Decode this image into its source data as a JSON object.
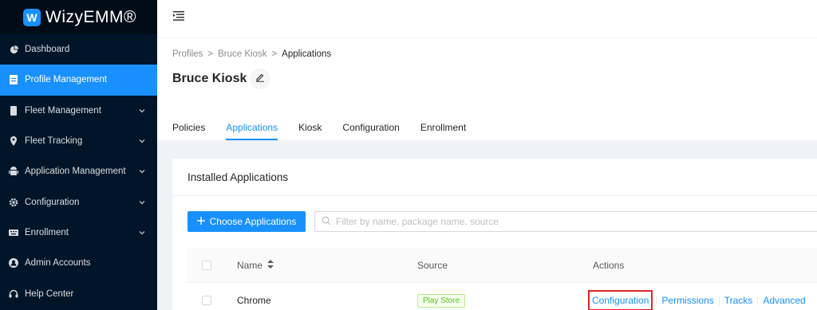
{
  "app": {
    "logo_letter": "W",
    "name": "WizyEMM®"
  },
  "sidebar": {
    "items": [
      {
        "label": "Dashboard",
        "icon": "dashboard-icon",
        "active": false,
        "expandable": false
      },
      {
        "label": "Profile Management",
        "icon": "profile-icon",
        "active": true,
        "expandable": false
      },
      {
        "label": "Fleet Management",
        "icon": "phone-icon",
        "active": false,
        "expandable": true
      },
      {
        "label": "Fleet Tracking",
        "icon": "location-icon",
        "active": false,
        "expandable": true
      },
      {
        "label": "Application Management",
        "icon": "android-icon",
        "active": false,
        "expandable": true
      },
      {
        "label": "Configuration",
        "icon": "gear-icon",
        "active": false,
        "expandable": true
      },
      {
        "label": "Enrollment",
        "icon": "keyboard-icon",
        "active": false,
        "expandable": true
      },
      {
        "label": "Admin Accounts",
        "icon": "admin-icon",
        "active": false,
        "expandable": false
      },
      {
        "label": "Help Center",
        "icon": "headset-icon",
        "active": false,
        "expandable": false
      }
    ]
  },
  "breadcrumb": {
    "items": [
      "Profiles",
      "Bruce Kiosk",
      "Applications"
    ],
    "separator": ">"
  },
  "page": {
    "title": "Bruce Kiosk"
  },
  "tabs": [
    {
      "label": "Policies",
      "active": false
    },
    {
      "label": "Applications",
      "active": true
    },
    {
      "label": "Kiosk",
      "active": false
    },
    {
      "label": "Configuration",
      "active": false
    },
    {
      "label": "Enrollment",
      "active": false
    }
  ],
  "card": {
    "title": "Installed Applications",
    "choose_button": "Choose Applications",
    "search_placeholder": "Filter by name, package name, source"
  },
  "table": {
    "columns": {
      "name": "Name",
      "source": "Source",
      "actions": "Actions"
    },
    "rows": [
      {
        "name": "Chrome",
        "source": "Play Store",
        "actions": [
          "Configuration",
          "Permissions",
          "Tracks",
          "Advanced"
        ]
      }
    ]
  },
  "colors": {
    "primary": "#1890ff",
    "sidebar_bg": "#001529",
    "highlight": "#e02424",
    "tag_green": "#52c41a"
  }
}
